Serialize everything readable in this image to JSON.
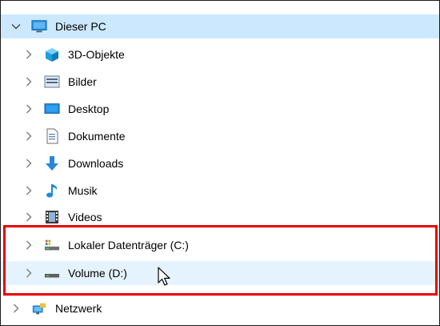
{
  "tree": {
    "root": {
      "label": "Dieser PC",
      "icon": "this-pc-monitor-icon",
      "expanded": true
    },
    "items": [
      {
        "label": "3D-Objekte",
        "icon": "3d-objects-icon"
      },
      {
        "label": "Bilder",
        "icon": "pictures-icon"
      },
      {
        "label": "Desktop",
        "icon": "desktop-folder-icon"
      },
      {
        "label": "Dokumente",
        "icon": "documents-icon"
      },
      {
        "label": "Downloads",
        "icon": "downloads-icon"
      },
      {
        "label": "Musik",
        "icon": "music-icon"
      },
      {
        "label": "Videos",
        "icon": "videos-icon"
      },
      {
        "label": "Lokaler Datenträger (C:)",
        "icon": "local-disk-icon"
      },
      {
        "label": "Volume (D:)",
        "icon": "volume-drive-icon",
        "hovered": true
      }
    ],
    "network": {
      "label": "Netzwerk",
      "icon": "network-icon"
    }
  },
  "colors": {
    "selected_row": "#cce8ff",
    "hover_row": "#e5f3ff",
    "highlight_border": "#e60000",
    "chevron": "#7a7a7a"
  }
}
